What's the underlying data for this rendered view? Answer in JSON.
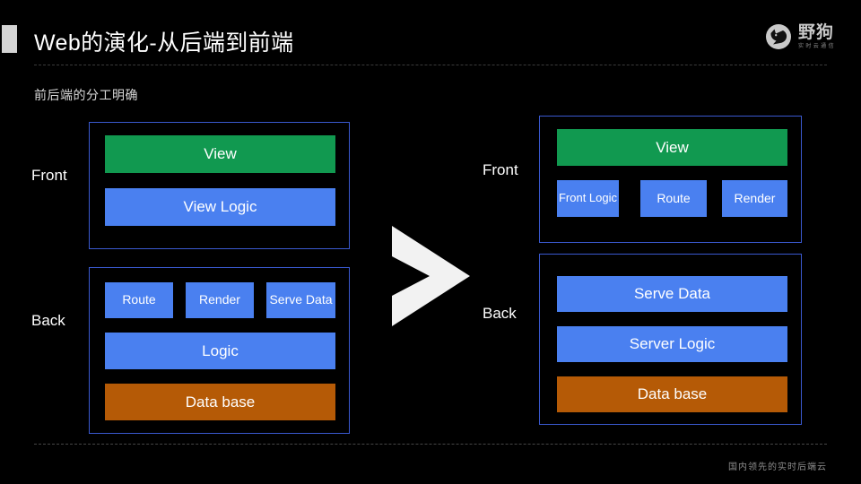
{
  "slide": {
    "title": "Web的演化-从后端到前端",
    "subtitle": "前后端的分工明确",
    "footer_note": "国内领先的实时后端云"
  },
  "brand": {
    "name": "野狗",
    "tagline": "实时云通信",
    "logo_icon": "wolf-head-icon"
  },
  "colors": {
    "background": "#000000",
    "frame_border": "#3a59d0",
    "view_green": "#119950",
    "logic_blue": "#4a80f0",
    "database_orange": "#b55a06",
    "accent_square": "#d4d4d4",
    "arrow_white": "#f2f2f2"
  },
  "diagram": {
    "arrow_icon": "chevron-right-icon",
    "left": {
      "front": {
        "label": "Front",
        "boxes": [
          {
            "text": "View",
            "color": "green"
          },
          {
            "text": "View Logic",
            "color": "blue"
          }
        ]
      },
      "back": {
        "label": "Back",
        "row": [
          {
            "text": "Route",
            "color": "blue"
          },
          {
            "text": "Render",
            "color": "blue"
          },
          {
            "text": "Serve Data",
            "color": "blue"
          }
        ],
        "boxes": [
          {
            "text": "Logic",
            "color": "blue"
          },
          {
            "text": "Data base",
            "color": "orange"
          }
        ]
      }
    },
    "right": {
      "front": {
        "label": "Front",
        "boxes": [
          {
            "text": "View",
            "color": "green"
          }
        ],
        "row": [
          {
            "text": "Front Logic",
            "color": "blue"
          },
          {
            "text": "Route",
            "color": "blue"
          },
          {
            "text": "Render",
            "color": "blue"
          }
        ]
      },
      "back": {
        "label": "Back",
        "boxes": [
          {
            "text": "Serve Data",
            "color": "blue"
          },
          {
            "text": "Server Logic",
            "color": "blue"
          },
          {
            "text": "Data base",
            "color": "orange"
          }
        ]
      }
    }
  }
}
